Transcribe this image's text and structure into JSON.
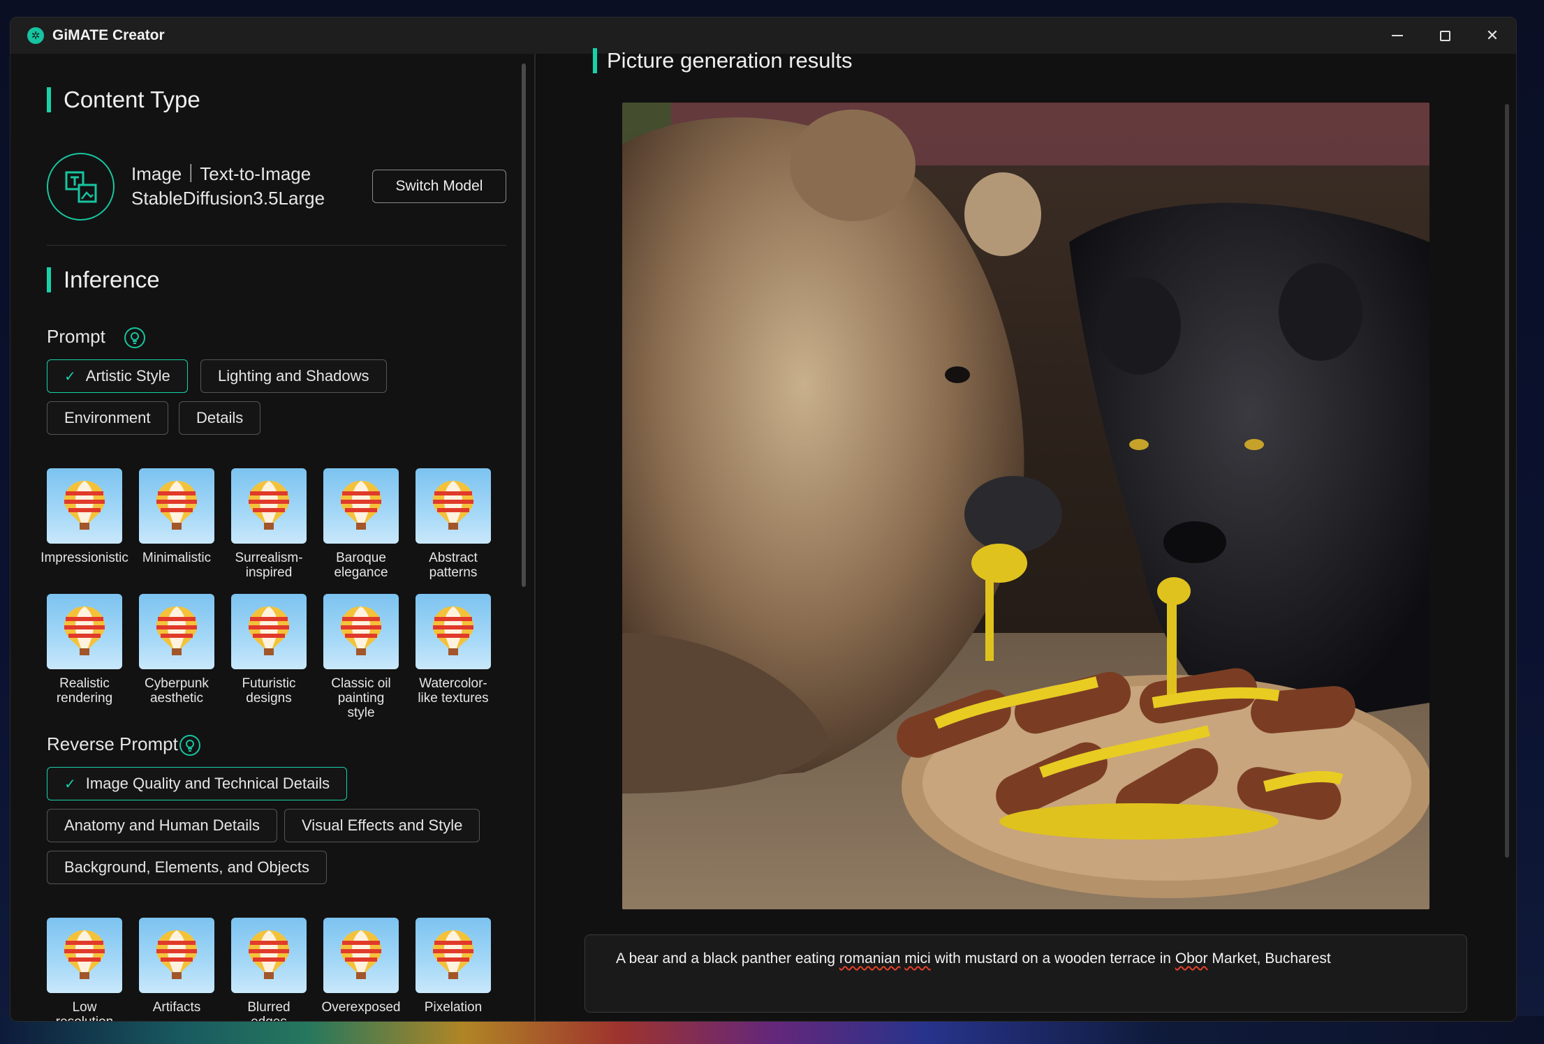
{
  "window": {
    "title": "GiMATE Creator"
  },
  "content_type": {
    "heading": "Content Type",
    "mode_line": "Image｜Text-to-Image",
    "model_name": "StableDiffusion3.5Large",
    "switch_label": "Switch Model"
  },
  "inference": {
    "heading": "Inference",
    "prompt_label": "Prompt",
    "prompt_categories": [
      {
        "label": "Artistic Style",
        "active": true
      },
      {
        "label": "Lighting and Shadows",
        "active": false
      },
      {
        "label": "Environment",
        "active": false
      },
      {
        "label": "Details",
        "active": false
      }
    ],
    "style_tiles": [
      "Impressionistic",
      "Minimalistic",
      "Surrealism-\ninspired",
      "Baroque\nelegance",
      "Abstract\npatterns",
      "Realistic\nrendering",
      "Cyberpunk\naesthetic",
      "Futuristic\ndesigns",
      "Classic oil\npainting\nstyle",
      "Watercolor-\nlike textures"
    ],
    "reverse_label": "Reverse Prompt",
    "reverse_categories": [
      {
        "label": "Image Quality and Technical Details",
        "active": true
      },
      {
        "label": "Anatomy and Human Details",
        "active": false
      },
      {
        "label": "Visual Effects and Style",
        "active": false
      },
      {
        "label": "Background, Elements, and Objects",
        "active": false
      }
    ],
    "reverse_tiles": [
      "Low\nresolution",
      "Artifacts",
      "Blurred\nedges",
      "Overexposed",
      "Pixelation"
    ]
  },
  "results": {
    "heading": "Picture generation results",
    "prompt_parts": [
      "A bear and a black panther eating ",
      "romanian",
      " ",
      "mici",
      " with mustard on a wooden terrace in ",
      "Obor",
      " Market, Bucharest"
    ]
  },
  "colors": {
    "accent": "#19d1a8",
    "panel": "#121212",
    "titlebar": "#1e1e1e"
  },
  "icons": {
    "app": "gimate-logo-icon",
    "model": "text-to-image-icon",
    "bulb": "lightbulb-icon",
    "tile": "hot-air-balloon-icon",
    "check": "check-icon"
  }
}
